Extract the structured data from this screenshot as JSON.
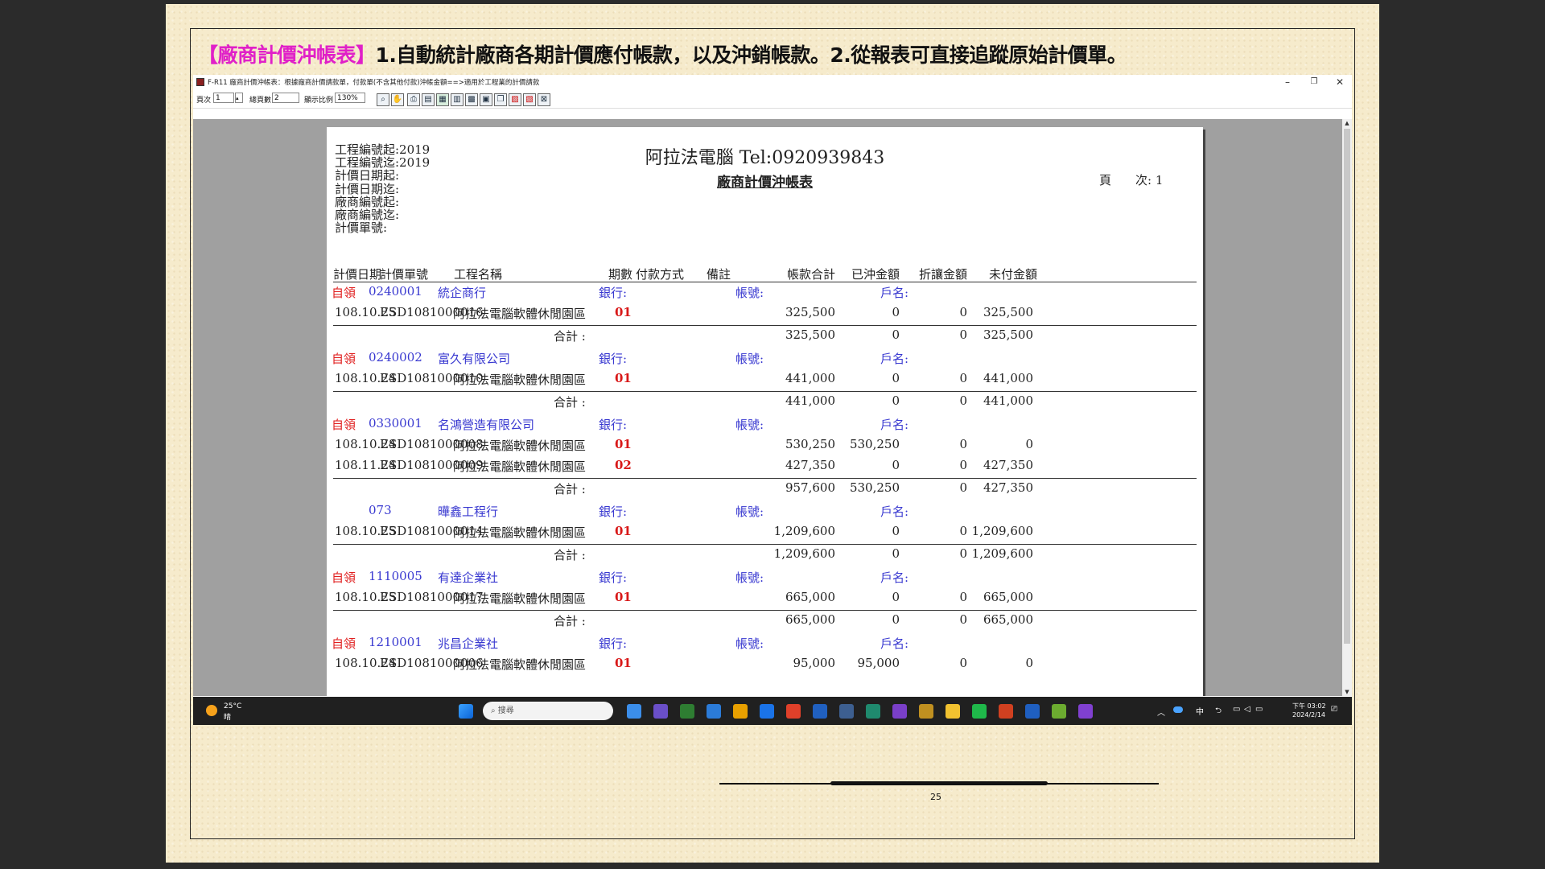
{
  "caption": {
    "highlight": "【廠商計價沖帳表】",
    "rest": "1.自動統計廠商各期計價應付帳款，以及沖銷帳款。2.從報表可直接追蹤原始計價單。"
  },
  "window": {
    "title": "F-R11 廠商計價沖帳表：根據廠商計價請款單，付款單(不含其他付款)沖帳金額==>適用於工程業的計價請款",
    "minimize": "–",
    "maximize": "❐",
    "close": "✕"
  },
  "toolbar": {
    "page_label": "頁次",
    "page_value": "1",
    "total_label": "總頁數",
    "total_value": "2",
    "zoom_label": "顯示比例",
    "zoom_value": "130%",
    "tool_icons": [
      "magnifier-icon",
      "hand-icon",
      "print-icon",
      "page-icon",
      "export-excel-icon",
      "export-word-icon",
      "export-image-icon",
      "export-doc-icon",
      "copy-icon",
      "export-pdf-icon",
      "export-chart-icon",
      "close-icon"
    ]
  },
  "report": {
    "criteria": [
      "工程編號起:2019",
      "工程編號迄:2019",
      "計價日期起:",
      "計價日期迄:",
      "廠商編號起:",
      "廠商編號迄:",
      "計價單號:"
    ],
    "company": "阿拉法電腦 Tel:0920939843",
    "title": "廠商計價沖帳表",
    "page_label": "頁　　次:",
    "page_value": "1",
    "headers": [
      "計價日期",
      "計價單號",
      "工程名稱",
      "期數",
      "付款方式",
      "備註",
      "帳款合計",
      "已沖金額",
      "折讓金額",
      "未付金額"
    ],
    "labels": {
      "bank": "銀行:",
      "account": "帳號:",
      "holder": "戶名:",
      "subtotal": "合計 :"
    },
    "vendors": [
      {
        "type": "自領",
        "code": "0240001",
        "name": "統企商行",
        "rows": [
          {
            "date": "108.10.25",
            "no": "ESD1081000016",
            "project": "阿拉法電腦軟體休閒園區",
            "period": "01",
            "total": "325,500",
            "paid": "0",
            "discount": "0",
            "unpaid": "325,500"
          }
        ],
        "sum": {
          "total": "325,500",
          "paid": "0",
          "discount": "0",
          "unpaid": "325,500"
        }
      },
      {
        "type": "自領",
        "code": "0240002",
        "name": "富久有限公司",
        "rows": [
          {
            "date": "108.10.24",
            "no": "ESD1081000010",
            "project": "阿拉法電腦軟體休閒園區",
            "period": "01",
            "total": "441,000",
            "paid": "0",
            "discount": "0",
            "unpaid": "441,000"
          }
        ],
        "sum": {
          "total": "441,000",
          "paid": "0",
          "discount": "0",
          "unpaid": "441,000"
        }
      },
      {
        "type": "自領",
        "code": "0330001",
        "name": "名鴻營造有限公司",
        "rows": [
          {
            "date": "108.10.24",
            "no": "ESD1081000008",
            "project": "阿拉法電腦軟體休閒園區",
            "period": "01",
            "total": "530,250",
            "paid": "530,250",
            "discount": "0",
            "unpaid": "0"
          },
          {
            "date": "108.11.24",
            "no": "ESD1081000009",
            "project": "阿拉法電腦軟體休閒園區",
            "period": "02",
            "total": "427,350",
            "paid": "0",
            "discount": "0",
            "unpaid": "427,350"
          }
        ],
        "sum": {
          "total": "957,600",
          "paid": "530,250",
          "discount": "0",
          "unpaid": "427,350"
        }
      },
      {
        "type": "",
        "code": "073",
        "name": "曄鑫工程行",
        "rows": [
          {
            "date": "108.10.25",
            "no": "ESD1081000014",
            "project": "阿拉法電腦軟體休閒園區",
            "period": "01",
            "total": "1,209,600",
            "paid": "0",
            "discount": "0",
            "unpaid": "1,209,600"
          }
        ],
        "sum": {
          "total": "1,209,600",
          "paid": "0",
          "discount": "0",
          "unpaid": "1,209,600"
        }
      },
      {
        "type": "自領",
        "code": "1110005",
        "name": "有達企業社",
        "rows": [
          {
            "date": "108.10.25",
            "no": "ESD1081000017",
            "project": "阿拉法電腦軟體休閒園區",
            "period": "01",
            "total": "665,000",
            "paid": "0",
            "discount": "0",
            "unpaid": "665,000"
          }
        ],
        "sum": {
          "total": "665,000",
          "paid": "0",
          "discount": "0",
          "unpaid": "665,000"
        }
      },
      {
        "type": "自領",
        "code": "1210001",
        "name": "兆昌企業社",
        "rows": [
          {
            "date": "108.10.24",
            "no": "ESD1081000006",
            "project": "阿拉法電腦軟體休閒園區",
            "period": "01",
            "total": "95,000",
            "paid": "95,000",
            "discount": "0",
            "unpaid": "0"
          }
        ],
        "sum": null
      }
    ]
  },
  "taskbar": {
    "weather_temp": "25°C",
    "weather_desc": "晴",
    "search_placeholder": "搜尋",
    "ime": "中",
    "time": "下午 03:02",
    "date": "2024/2/14",
    "colors": [
      "#3b8eea",
      "#6a4fc8",
      "#2e7d32",
      "#2b7bd8",
      "#e8a000",
      "#1a73e8",
      "#e0402a",
      "#2060c0",
      "#3d5f90",
      "#1f8a6e",
      "#7a3fc8",
      "#c09020",
      "#f2c230",
      "#1fb84a",
      "#d04020",
      "#1f5fc0",
      "#6cab30",
      "#8040d0"
    ]
  },
  "footer": {
    "page_number": "25"
  }
}
